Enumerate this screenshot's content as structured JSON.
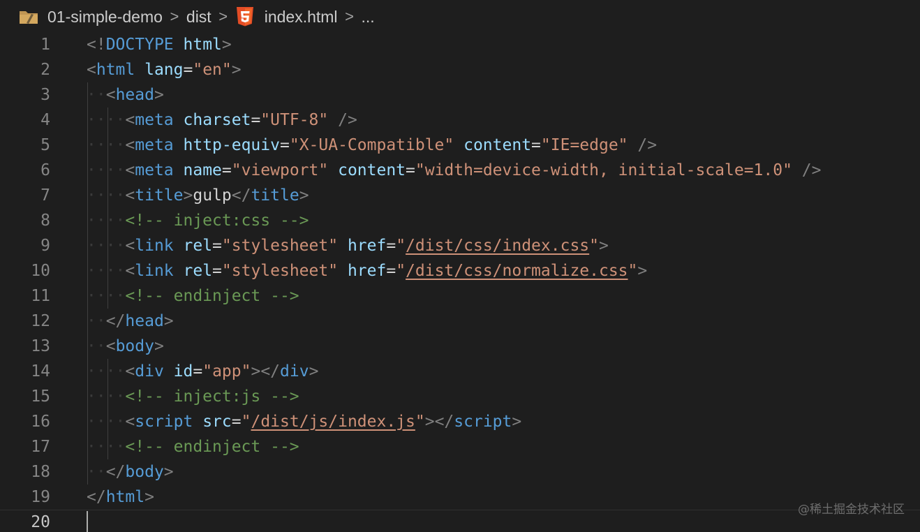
{
  "breadcrumb": {
    "items": [
      "01-simple-demo",
      "dist",
      "index.html",
      "..."
    ],
    "separator": ">"
  },
  "colors": {
    "background": "#1e1e1e",
    "tag": "#569cd6",
    "attribute": "#9cdcfe",
    "string": "#ce9178",
    "comment": "#6a9955",
    "punctuation": "#808080",
    "text": "#d4d4d4",
    "line_number": "#858585",
    "html5_icon": "#e44d26",
    "folder_icon": "#c09553"
  },
  "editor": {
    "current_line": 20,
    "lines": [
      {
        "n": "1",
        "indent": 0,
        "tokens": [
          [
            "p",
            "<!"
          ],
          [
            "t",
            "DOCTYPE"
          ],
          [
            "x",
            " "
          ],
          [
            "a",
            "html"
          ],
          [
            "p",
            ">"
          ]
        ]
      },
      {
        "n": "2",
        "indent": 0,
        "tokens": [
          [
            "p",
            "<"
          ],
          [
            "t",
            "html"
          ],
          [
            "x",
            " "
          ],
          [
            "a",
            "lang"
          ],
          [
            "x",
            "="
          ],
          [
            "s",
            "\"en\""
          ],
          [
            "p",
            ">"
          ]
        ]
      },
      {
        "n": "3",
        "indent": 1,
        "tokens": [
          [
            "p",
            "<"
          ],
          [
            "t",
            "head"
          ],
          [
            "p",
            ">"
          ]
        ]
      },
      {
        "n": "4",
        "indent": 2,
        "tokens": [
          [
            "p",
            "<"
          ],
          [
            "t",
            "meta"
          ],
          [
            "x",
            " "
          ],
          [
            "a",
            "charset"
          ],
          [
            "x",
            "="
          ],
          [
            "s",
            "\"UTF-8\""
          ],
          [
            "x",
            " "
          ],
          [
            "p",
            "/>"
          ]
        ]
      },
      {
        "n": "5",
        "indent": 2,
        "tokens": [
          [
            "p",
            "<"
          ],
          [
            "t",
            "meta"
          ],
          [
            "x",
            " "
          ],
          [
            "a",
            "http-equiv"
          ],
          [
            "x",
            "="
          ],
          [
            "s",
            "\"X-UA-Compatible\""
          ],
          [
            "x",
            " "
          ],
          [
            "a",
            "content"
          ],
          [
            "x",
            "="
          ],
          [
            "s",
            "\"IE=edge\""
          ],
          [
            "x",
            " "
          ],
          [
            "p",
            "/>"
          ]
        ]
      },
      {
        "n": "6",
        "indent": 2,
        "tokens": [
          [
            "p",
            "<"
          ],
          [
            "t",
            "meta"
          ],
          [
            "x",
            " "
          ],
          [
            "a",
            "name"
          ],
          [
            "x",
            "="
          ],
          [
            "s",
            "\"viewport\""
          ],
          [
            "x",
            " "
          ],
          [
            "a",
            "content"
          ],
          [
            "x",
            "="
          ],
          [
            "s",
            "\"width=device-width, initial-scale=1.0\""
          ],
          [
            "x",
            " "
          ],
          [
            "p",
            "/>"
          ]
        ]
      },
      {
        "n": "7",
        "indent": 2,
        "tokens": [
          [
            "p",
            "<"
          ],
          [
            "t",
            "title"
          ],
          [
            "p",
            ">"
          ],
          [
            "x",
            "gulp"
          ],
          [
            "p",
            "</"
          ],
          [
            "t",
            "title"
          ],
          [
            "p",
            ">"
          ]
        ]
      },
      {
        "n": "8",
        "indent": 2,
        "tokens": [
          [
            "c",
            "<!-- inject:css -->"
          ]
        ]
      },
      {
        "n": "9",
        "indent": 2,
        "tokens": [
          [
            "p",
            "<"
          ],
          [
            "t",
            "link"
          ],
          [
            "x",
            " "
          ],
          [
            "a",
            "rel"
          ],
          [
            "x",
            "="
          ],
          [
            "s",
            "\"stylesheet\""
          ],
          [
            "x",
            " "
          ],
          [
            "a",
            "href"
          ],
          [
            "x",
            "="
          ],
          [
            "s",
            "\""
          ],
          [
            "u",
            "/dist/css/index.css"
          ],
          [
            "s",
            "\""
          ],
          [
            "p",
            ">"
          ]
        ]
      },
      {
        "n": "10",
        "indent": 2,
        "tokens": [
          [
            "p",
            "<"
          ],
          [
            "t",
            "link"
          ],
          [
            "x",
            " "
          ],
          [
            "a",
            "rel"
          ],
          [
            "x",
            "="
          ],
          [
            "s",
            "\"stylesheet\""
          ],
          [
            "x",
            " "
          ],
          [
            "a",
            "href"
          ],
          [
            "x",
            "="
          ],
          [
            "s",
            "\""
          ],
          [
            "u",
            "/dist/css/normalize.css"
          ],
          [
            "s",
            "\""
          ],
          [
            "p",
            ">"
          ]
        ]
      },
      {
        "n": "11",
        "indent": 2,
        "tokens": [
          [
            "c",
            "<!-- endinject -->"
          ]
        ]
      },
      {
        "n": "12",
        "indent": 1,
        "tokens": [
          [
            "p",
            "</"
          ],
          [
            "t",
            "head"
          ],
          [
            "p",
            ">"
          ]
        ]
      },
      {
        "n": "13",
        "indent": 1,
        "tokens": [
          [
            "p",
            "<"
          ],
          [
            "t",
            "body"
          ],
          [
            "p",
            ">"
          ]
        ]
      },
      {
        "n": "14",
        "indent": 2,
        "tokens": [
          [
            "p",
            "<"
          ],
          [
            "t",
            "div"
          ],
          [
            "x",
            " "
          ],
          [
            "a",
            "id"
          ],
          [
            "x",
            "="
          ],
          [
            "s",
            "\"app\""
          ],
          [
            "p",
            "></"
          ],
          [
            "t",
            "div"
          ],
          [
            "p",
            ">"
          ]
        ]
      },
      {
        "n": "15",
        "indent": 2,
        "tokens": [
          [
            "c",
            "<!-- inject:js -->"
          ]
        ]
      },
      {
        "n": "16",
        "indent": 2,
        "tokens": [
          [
            "p",
            "<"
          ],
          [
            "t",
            "script"
          ],
          [
            "x",
            " "
          ],
          [
            "a",
            "src"
          ],
          [
            "x",
            "="
          ],
          [
            "s",
            "\""
          ],
          [
            "u",
            "/dist/js/index.js"
          ],
          [
            "s",
            "\""
          ],
          [
            "p",
            "></"
          ],
          [
            "t",
            "script"
          ],
          [
            "p",
            ">"
          ]
        ]
      },
      {
        "n": "17",
        "indent": 2,
        "tokens": [
          [
            "c",
            "<!-- endinject -->"
          ]
        ]
      },
      {
        "n": "18",
        "indent": 1,
        "tokens": [
          [
            "p",
            "</"
          ],
          [
            "t",
            "body"
          ],
          [
            "p",
            ">"
          ]
        ]
      },
      {
        "n": "19",
        "indent": 0,
        "tokens": [
          [
            "p",
            "</"
          ],
          [
            "t",
            "html"
          ],
          [
            "p",
            ">"
          ]
        ]
      },
      {
        "n": "20",
        "indent": 0,
        "tokens": []
      }
    ]
  },
  "watermark": "@稀土掘金技术社区"
}
